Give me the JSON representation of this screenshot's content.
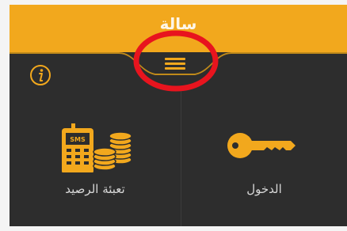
{
  "header": {
    "title": "سالة",
    "background_color": "#f2a81d"
  },
  "menu": {
    "icon": "hamburger-menu-icon"
  },
  "info": {
    "icon": "info-icon"
  },
  "tiles": [
    {
      "label": "تعبئة الرصيد",
      "icon": "phone-coins-icon"
    },
    {
      "label": "الدخول",
      "icon": "key-icon"
    }
  ],
  "colors": {
    "accent": "#f2a81d",
    "background": "#2d2d2d",
    "label_text": "#d8d8d8",
    "annotation": "#e8141e"
  }
}
